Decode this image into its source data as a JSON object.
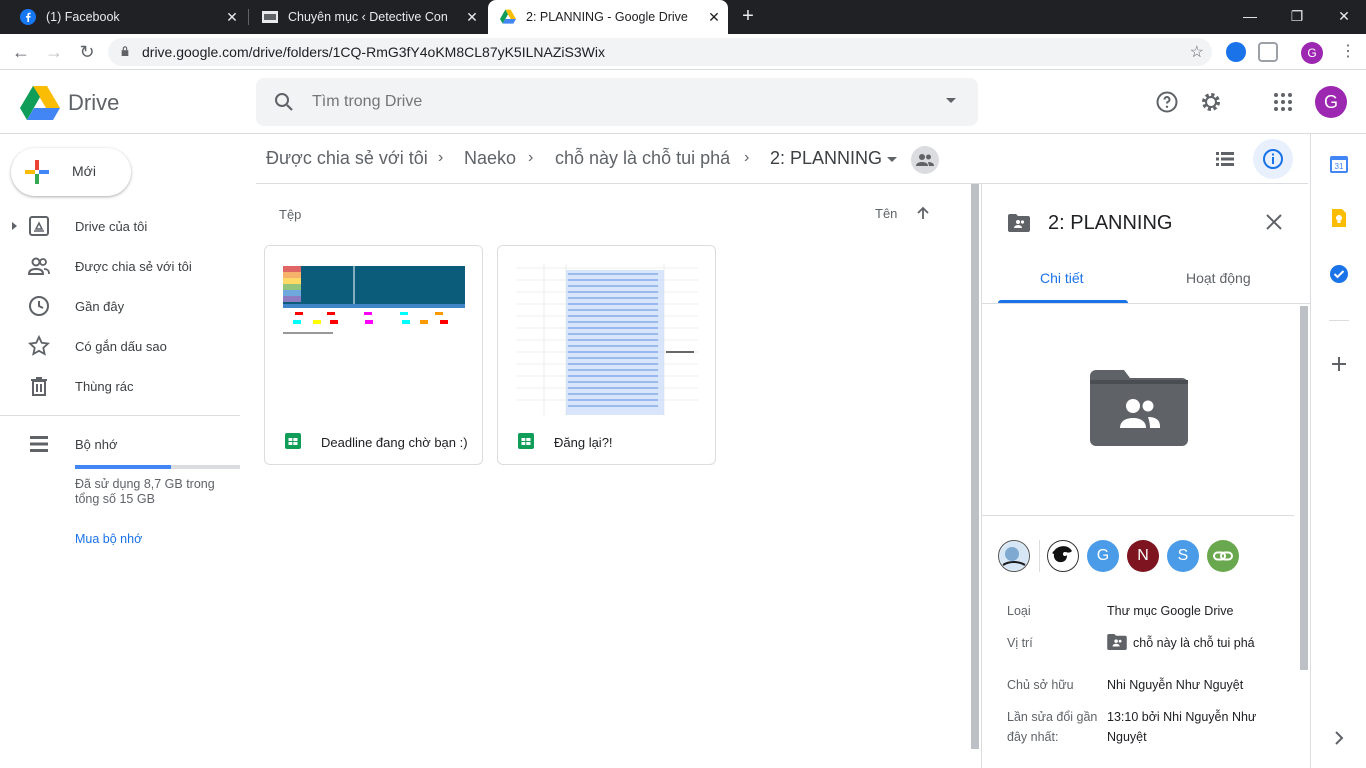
{
  "browser": {
    "tabs": [
      {
        "title": "(1) Facebook",
        "active": false
      },
      {
        "title": "Chuyên mục ‹ Detective Conan-V",
        "active": false
      },
      {
        "title": "2: PLANNING - Google Drive",
        "active": true
      }
    ],
    "url": "drive.google.com/drive/folders/1CQ-RmG3fY4oKM8CL87yK5ILNAZiS3Wix",
    "profile_initial": "G"
  },
  "header": {
    "app_name": "Drive",
    "search_placeholder": "Tìm trong Drive",
    "avatar_initial": "G"
  },
  "sidebar": {
    "new_label": "Mới",
    "items": [
      {
        "label": "Drive của tôi",
        "icon": "my-drive-icon"
      },
      {
        "label": "Được chia sẻ với tôi",
        "icon": "shared-icon"
      },
      {
        "label": "Gần đây",
        "icon": "clock-icon"
      },
      {
        "label": "Có gắn dấu sao",
        "icon": "star-icon"
      },
      {
        "label": "Thùng rác",
        "icon": "trash-icon"
      }
    ],
    "storage": {
      "label": "Bộ nhớ",
      "usage_text": "Đã sử dụng 8,7 GB trong tổng số 15 GB",
      "used_fraction": 0.58,
      "buy_label": "Mua bộ nhớ"
    }
  },
  "breadcrumb": [
    "Được chia sẻ với tôi",
    "Naeko",
    "chỗ này là chỗ tui phá",
    "2: PLANNING"
  ],
  "files": {
    "section_label": "Tệp",
    "sort_label": "Tên",
    "items": [
      {
        "name": "Deadline đang chờ bạn :)",
        "icon": "sheets-icon"
      },
      {
        "name": "Đăng lại?!",
        "icon": "sheets-icon"
      }
    ]
  },
  "details": {
    "title": "2: PLANNING",
    "tabs": [
      "Chi tiết",
      "Hoạt động"
    ],
    "sharers": [
      {
        "initial": "",
        "color": "#e3eef8"
      },
      {
        "initial": "",
        "color": "#ffffff"
      },
      {
        "initial": "G",
        "color": "#4a9be8"
      },
      {
        "initial": "N",
        "color": "#7d1420"
      },
      {
        "initial": "S",
        "color": "#4a9be8"
      },
      {
        "initial": "",
        "color": "#6aa84f"
      }
    ],
    "props": [
      {
        "label": "Loại",
        "value": "Thư mục Google Drive"
      },
      {
        "label": "Vị trí",
        "value": "chỗ này là chỗ tui phá"
      },
      {
        "label": "Chủ sở hữu",
        "value": "Nhi Nguyễn Như Nguyệt"
      },
      {
        "label": "Lần sửa đổi gần đây nhất:",
        "value": "13:10 bởi Nhi Nguyễn Như Nguyệt"
      }
    ]
  },
  "colors": {
    "accent": "#1a73e8",
    "chrome_dark": "#202124",
    "folder": "#5f6368",
    "sheets_green": "#0f9d58"
  }
}
